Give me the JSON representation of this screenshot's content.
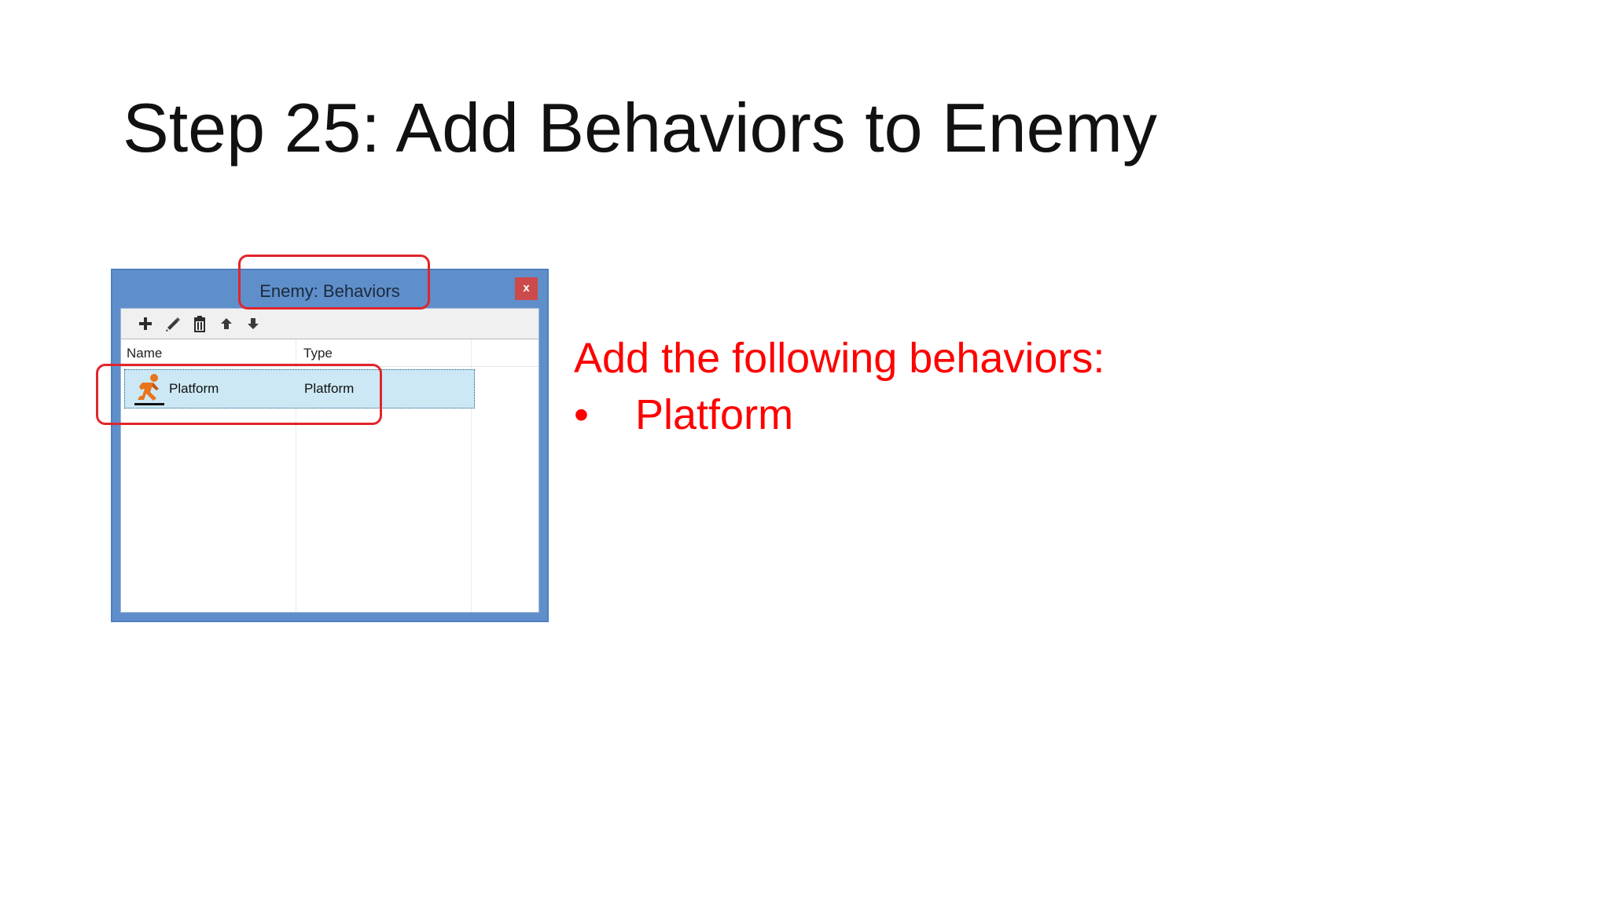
{
  "slide": {
    "title": "Step 25: Add Behaviors to Enemy"
  },
  "dialog": {
    "title": "Enemy: Behaviors",
    "close_label": "x",
    "toolbar": [
      {
        "name": "add-behavior-button",
        "icon": "plus-icon"
      },
      {
        "name": "edit-behavior-button",
        "icon": "pencil-icon"
      },
      {
        "name": "delete-behavior-button",
        "icon": "trash-icon"
      },
      {
        "name": "move-up-button",
        "icon": "arrow-up-icon"
      },
      {
        "name": "move-down-button",
        "icon": "arrow-down-icon"
      }
    ],
    "columns": {
      "name": "Name",
      "type": "Type"
    },
    "rows": [
      {
        "name": "Platform",
        "type": "Platform",
        "icon": "running-man-icon",
        "selected": true
      }
    ]
  },
  "instructions": {
    "heading": "Add the following behaviors:",
    "bullet_symbol": "•",
    "items": [
      "Platform"
    ]
  },
  "colors": {
    "annotation": "#e0262b",
    "instruction_text": "#ff0000",
    "dialog_frame": "#5f8fcb",
    "selection": "#cce8f4"
  }
}
